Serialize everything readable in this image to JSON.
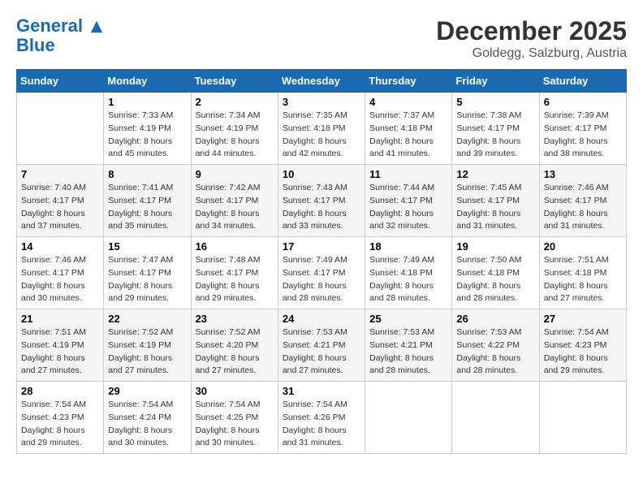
{
  "header": {
    "logo_line1": "General",
    "logo_line2": "Blue",
    "month": "December 2025",
    "location": "Goldegg, Salzburg, Austria"
  },
  "weekdays": [
    "Sunday",
    "Monday",
    "Tuesday",
    "Wednesday",
    "Thursday",
    "Friday",
    "Saturday"
  ],
  "weeks": [
    [
      {
        "day": "",
        "info": ""
      },
      {
        "day": "1",
        "info": "Sunrise: 7:33 AM\nSunset: 4:19 PM\nDaylight: 8 hours\nand 45 minutes."
      },
      {
        "day": "2",
        "info": "Sunrise: 7:34 AM\nSunset: 4:19 PM\nDaylight: 8 hours\nand 44 minutes."
      },
      {
        "day": "3",
        "info": "Sunrise: 7:35 AM\nSunset: 4:18 PM\nDaylight: 8 hours\nand 42 minutes."
      },
      {
        "day": "4",
        "info": "Sunrise: 7:37 AM\nSunset: 4:18 PM\nDaylight: 8 hours\nand 41 minutes."
      },
      {
        "day": "5",
        "info": "Sunrise: 7:38 AM\nSunset: 4:17 PM\nDaylight: 8 hours\nand 39 minutes."
      },
      {
        "day": "6",
        "info": "Sunrise: 7:39 AM\nSunset: 4:17 PM\nDaylight: 8 hours\nand 38 minutes."
      }
    ],
    [
      {
        "day": "7",
        "info": "Sunrise: 7:40 AM\nSunset: 4:17 PM\nDaylight: 8 hours\nand 37 minutes."
      },
      {
        "day": "8",
        "info": "Sunrise: 7:41 AM\nSunset: 4:17 PM\nDaylight: 8 hours\nand 35 minutes."
      },
      {
        "day": "9",
        "info": "Sunrise: 7:42 AM\nSunset: 4:17 PM\nDaylight: 8 hours\nand 34 minutes."
      },
      {
        "day": "10",
        "info": "Sunrise: 7:43 AM\nSunset: 4:17 PM\nDaylight: 8 hours\nand 33 minutes."
      },
      {
        "day": "11",
        "info": "Sunrise: 7:44 AM\nSunset: 4:17 PM\nDaylight: 8 hours\nand 32 minutes."
      },
      {
        "day": "12",
        "info": "Sunrise: 7:45 AM\nSunset: 4:17 PM\nDaylight: 8 hours\nand 31 minutes."
      },
      {
        "day": "13",
        "info": "Sunrise: 7:46 AM\nSunset: 4:17 PM\nDaylight: 8 hours\nand 31 minutes."
      }
    ],
    [
      {
        "day": "14",
        "info": "Sunrise: 7:46 AM\nSunset: 4:17 PM\nDaylight: 8 hours\nand 30 minutes."
      },
      {
        "day": "15",
        "info": "Sunrise: 7:47 AM\nSunset: 4:17 PM\nDaylight: 8 hours\nand 29 minutes."
      },
      {
        "day": "16",
        "info": "Sunrise: 7:48 AM\nSunset: 4:17 PM\nDaylight: 8 hours\nand 29 minutes."
      },
      {
        "day": "17",
        "info": "Sunrise: 7:49 AM\nSunset: 4:17 PM\nDaylight: 8 hours\nand 28 minutes."
      },
      {
        "day": "18",
        "info": "Sunrise: 7:49 AM\nSunset: 4:18 PM\nDaylight: 8 hours\nand 28 minutes."
      },
      {
        "day": "19",
        "info": "Sunrise: 7:50 AM\nSunset: 4:18 PM\nDaylight: 8 hours\nand 28 minutes."
      },
      {
        "day": "20",
        "info": "Sunrise: 7:51 AM\nSunset: 4:18 PM\nDaylight: 8 hours\nand 27 minutes."
      }
    ],
    [
      {
        "day": "21",
        "info": "Sunrise: 7:51 AM\nSunset: 4:19 PM\nDaylight: 8 hours\nand 27 minutes."
      },
      {
        "day": "22",
        "info": "Sunrise: 7:52 AM\nSunset: 4:19 PM\nDaylight: 8 hours\nand 27 minutes."
      },
      {
        "day": "23",
        "info": "Sunrise: 7:52 AM\nSunset: 4:20 PM\nDaylight: 8 hours\nand 27 minutes."
      },
      {
        "day": "24",
        "info": "Sunrise: 7:53 AM\nSunset: 4:21 PM\nDaylight: 8 hours\nand 27 minutes."
      },
      {
        "day": "25",
        "info": "Sunrise: 7:53 AM\nSunset: 4:21 PM\nDaylight: 8 hours\nand 28 minutes."
      },
      {
        "day": "26",
        "info": "Sunrise: 7:53 AM\nSunset: 4:22 PM\nDaylight: 8 hours\nand 28 minutes."
      },
      {
        "day": "27",
        "info": "Sunrise: 7:54 AM\nSunset: 4:23 PM\nDaylight: 8 hours\nand 29 minutes."
      }
    ],
    [
      {
        "day": "28",
        "info": "Sunrise: 7:54 AM\nSunset: 4:23 PM\nDaylight: 8 hours\nand 29 minutes."
      },
      {
        "day": "29",
        "info": "Sunrise: 7:54 AM\nSunset: 4:24 PM\nDaylight: 8 hours\nand 30 minutes."
      },
      {
        "day": "30",
        "info": "Sunrise: 7:54 AM\nSunset: 4:25 PM\nDaylight: 8 hours\nand 30 minutes."
      },
      {
        "day": "31",
        "info": "Sunrise: 7:54 AM\nSunset: 4:26 PM\nDaylight: 8 hours\nand 31 minutes."
      },
      {
        "day": "",
        "info": ""
      },
      {
        "day": "",
        "info": ""
      },
      {
        "day": "",
        "info": ""
      }
    ]
  ]
}
